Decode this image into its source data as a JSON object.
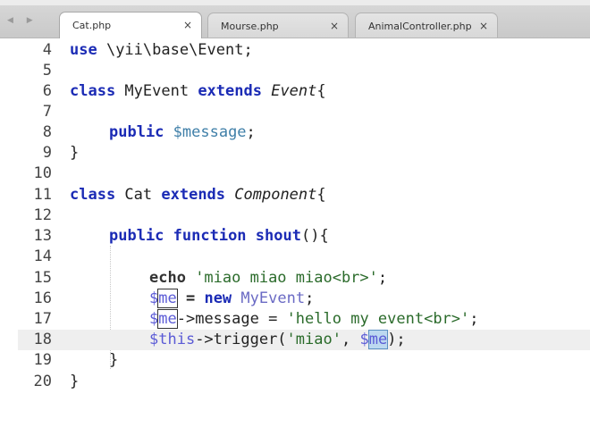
{
  "tabs": [
    {
      "label": "Cat.php",
      "close": "×",
      "active": true
    },
    {
      "label": "Mourse.php",
      "close": "×",
      "active": false
    },
    {
      "label": "AnimalController.php",
      "close": "×",
      "active": false
    }
  ],
  "nav_arrows": "◀ ▶",
  "current_line": 18,
  "lines": [
    {
      "n": "4"
    },
    {
      "n": "5"
    },
    {
      "n": "6"
    },
    {
      "n": "7"
    },
    {
      "n": "8"
    },
    {
      "n": "9"
    },
    {
      "n": "10"
    },
    {
      "n": "11"
    },
    {
      "n": "12"
    },
    {
      "n": "13"
    },
    {
      "n": "14"
    },
    {
      "n": "15"
    },
    {
      "n": "16"
    },
    {
      "n": "17"
    },
    {
      "n": "18"
    },
    {
      "n": "19"
    },
    {
      "n": "20"
    }
  ],
  "code": {
    "l4_use": "use",
    "l4_ns": " \\yii\\base\\Event;",
    "l6_class": "class",
    "l6_name": " MyEvent ",
    "l6_extends": "extends",
    "l6_parent": " Event",
    "l6_brace": "{",
    "l8_public": "public",
    "l8_var": " $message",
    "l8_semi": ";",
    "l9_brace": "}",
    "l11_class": "class",
    "l11_name": " Cat ",
    "l11_extends": "extends",
    "l11_parent": " Component",
    "l11_brace": "{",
    "l13_public": "public",
    "l13_function": " function",
    "l13_name": " shout",
    "l13_rest": "(){",
    "l15_echo": "echo",
    "l15_str": " 'miao miao miao<br>'",
    "l15_semi": ";",
    "l16_dollar": "$",
    "l16_me": "me",
    "l16_eq": " = ",
    "l16_new": "new",
    "l16_cls": " MyEvent",
    "l16_semi": ";",
    "l17_dollar": "$",
    "l17_me": "me",
    "l17_arrow": "->message = ",
    "l17_str": "'hello my event<br>'",
    "l17_semi": ";",
    "l18_this": "$this",
    "l18_call": "->trigger(",
    "l18_str": "'miao'",
    "l18_comma": ", ",
    "l18_dollar": "$",
    "l18_me": "me",
    "l18_end": ");",
    "l19_brace": "}",
    "l20_brace": "}"
  }
}
